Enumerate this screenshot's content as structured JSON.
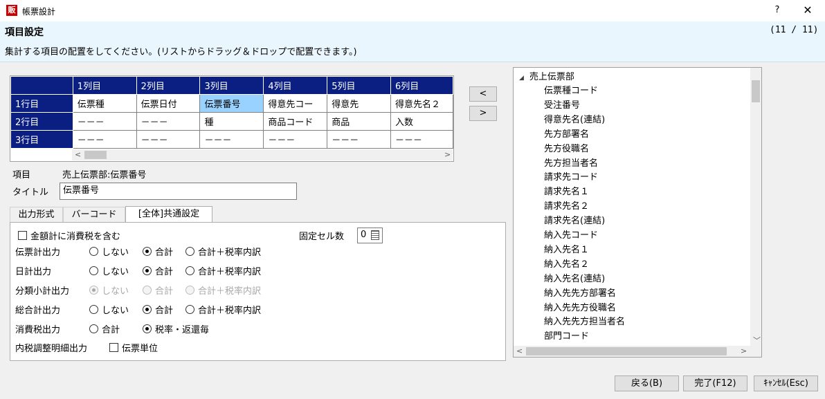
{
  "window": {
    "icon_text": "販",
    "title": "帳票設計",
    "help": "?",
    "close": "✕"
  },
  "header": {
    "title": "項目設定",
    "step": "(11 / 11)",
    "instruction": "集計する項目の配置をしてください。(リストからドラッグ＆ドロップで配置できます。)"
  },
  "grid": {
    "columns": [
      "1列目",
      "2列目",
      "3列目",
      "4列目",
      "5列目",
      "6列目"
    ],
    "rows": [
      {
        "label": "1行目",
        "cells": [
          "伝票種",
          "伝票日付",
          "伝票番号",
          "得意先コー",
          "得意先",
          "得意先名２"
        ]
      },
      {
        "label": "2行目",
        "cells": [
          "－－－",
          "－－－",
          "種",
          "商品コード",
          "商品",
          "入数"
        ]
      },
      {
        "label": "3行目",
        "cells": [
          "－－－",
          "－－－",
          "－－－",
          "－－－",
          "－－－",
          "－－－"
        ]
      }
    ],
    "selected": "伝票番号"
  },
  "move_buttons": {
    "left": "<",
    "right": ">"
  },
  "item": {
    "label": "項目",
    "value": "売上伝票部:伝票番号"
  },
  "title_field": {
    "label": "タイトル",
    "value": "伝票番号"
  },
  "tabs": [
    "出力形式",
    "バーコード",
    "[全体]共通設定"
  ],
  "panel": {
    "include_tax": {
      "label": "金額計に消費税を含む",
      "checked": false
    },
    "fixed_cells": {
      "label": "固定セル数",
      "value": "0"
    },
    "options": {
      "none": "しない",
      "total": "合計",
      "total_breakdown": "合計＋税率内訳"
    },
    "slip_total": {
      "label": "伝票計出力"
    },
    "daily_total": {
      "label": "日計出力"
    },
    "category_subtotal": {
      "label": "分類小計出力"
    },
    "grand_total": {
      "label": "総合計出力"
    },
    "tax_output": {
      "label": "消費税出力",
      "opt1": "合計",
      "opt2": "税率・返還毎"
    },
    "tax_adjust": {
      "label": "内税調整明細出力",
      "check_label": "伝票単位"
    }
  },
  "tree": {
    "root": "売上伝票部",
    "items": [
      "伝票種コード",
      "受注番号",
      "得意先名(連結)",
      "先方部署名",
      "先方役職名",
      "先方担当者名",
      "請求先コード",
      "請求先名１",
      "請求先名２",
      "請求先名(連結)",
      "納入先コード",
      "納入先名１",
      "納入先名２",
      "納入先名(連結)",
      "納入先先方部署名",
      "納入先先方役職名",
      "納入先先方担当者名",
      "部門コード"
    ]
  },
  "footer": {
    "back": "戻る(B)",
    "finish": "完了(F12)",
    "cancel": "ｷｬﾝｾﾙ(Esc)"
  }
}
